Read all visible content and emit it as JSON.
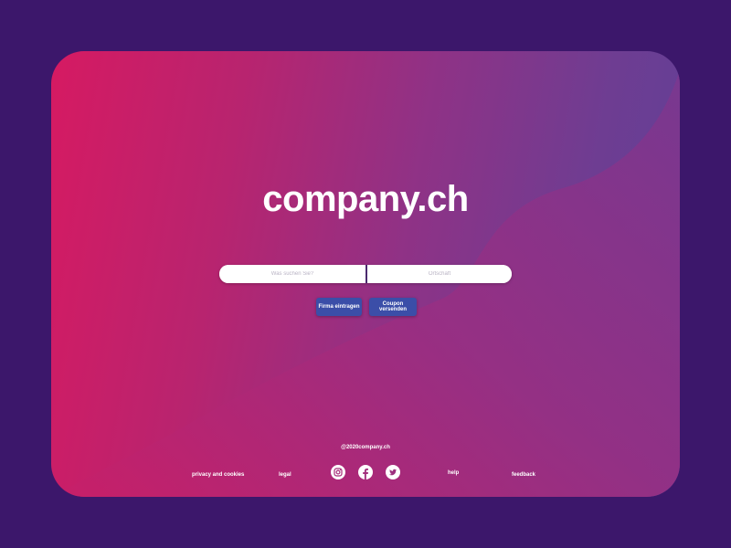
{
  "brand": {
    "logo_text": "company.ch"
  },
  "search": {
    "what_placeholder": "Was suchen Sie?",
    "where_placeholder": "Ortschaft"
  },
  "actions": {
    "firm_label": "Firma eintragen",
    "coupon_label": "Coupon versenden"
  },
  "footer": {
    "copyright": "@2020company.ch",
    "links": {
      "privacy": "privacy and cookies",
      "legal": "legal",
      "help": "help",
      "feedback": "feedback"
    },
    "social": [
      "instagram-icon",
      "facebook-icon",
      "twitter-icon"
    ]
  },
  "colors": {
    "page_background": "#3c176b",
    "gradient_start": "#d61a62",
    "gradient_end": "#5f3f98",
    "button": "#3b4ea8",
    "text": "#ffffff"
  }
}
